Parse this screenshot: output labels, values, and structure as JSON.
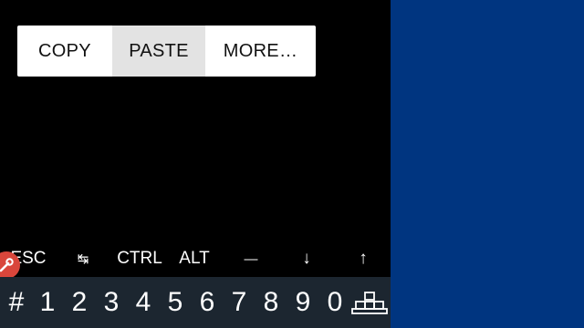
{
  "context_menu": {
    "copy": "COPY",
    "paste": "PASTE",
    "more": "MORE…"
  },
  "extra_keys": {
    "esc": "ESC",
    "tab": "↹",
    "ctrl": "CTRL",
    "alt": "ALT",
    "dash": "—",
    "down": "↓",
    "up": "↑"
  },
  "number_row": [
    "#",
    "1",
    "2",
    "3",
    "4",
    "5",
    "6",
    "7",
    "8",
    "9",
    "0"
  ],
  "icons": {
    "drawer_handle": "wrench-icon",
    "keyboard_toggle": "keyboard-icon"
  },
  "colors": {
    "terminal_bg": "#000000",
    "side_panel_bg": "#003580",
    "number_bar_bg": "#1c2630",
    "drawer_handle": "#d9463b",
    "menu_highlight": "#e3e3e3"
  }
}
